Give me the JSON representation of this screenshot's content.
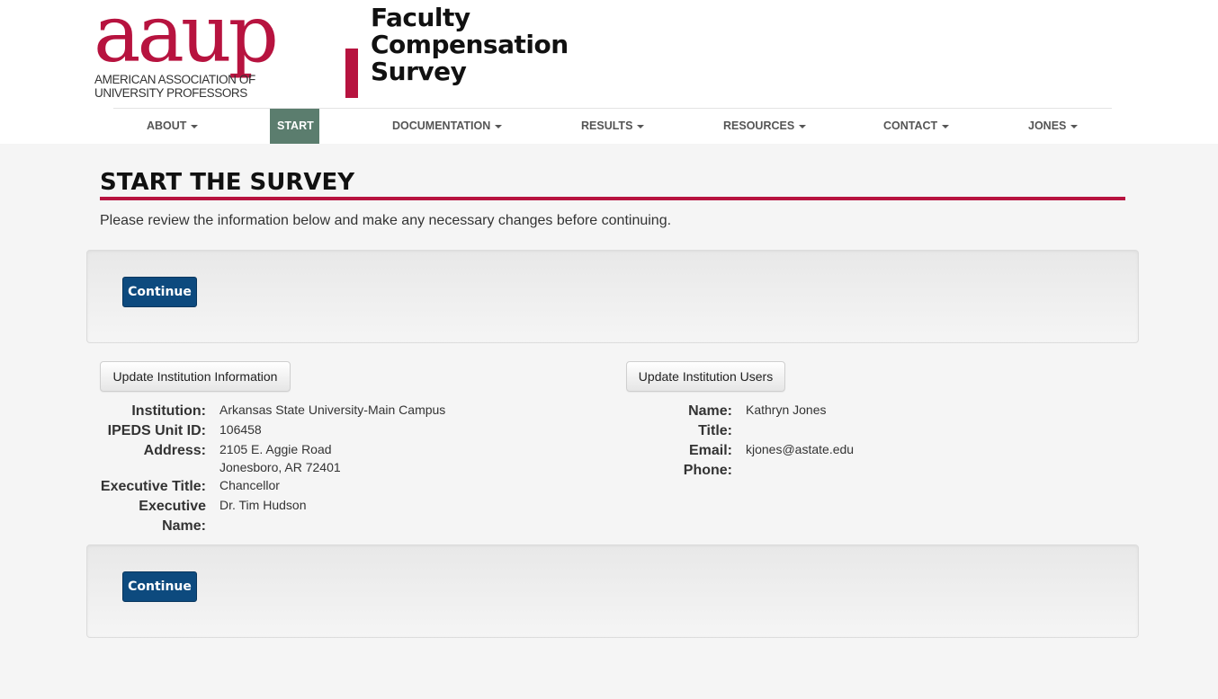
{
  "brand": {
    "logo_word": "aaup",
    "logo_sub": "American Association of University Professors",
    "site_title": "Faculty Compensation Survey",
    "brand_color": "#b7133f"
  },
  "nav": {
    "items": [
      {
        "label": "ABOUT",
        "dropdown": true
      },
      {
        "label": "START",
        "dropdown": false,
        "active": true
      },
      {
        "label": "DOCUMENTATION",
        "dropdown": true
      },
      {
        "label": "RESULTS",
        "dropdown": true
      },
      {
        "label": "RESOURCES",
        "dropdown": true
      },
      {
        "label": "CONTACT",
        "dropdown": true
      },
      {
        "label": "JONES",
        "dropdown": true
      }
    ],
    "active_color": "#5b7d6e"
  },
  "page": {
    "heading": "START THE SURVEY",
    "intro": "Please review the information below and make any necessary changes before continuing.",
    "continue_label": "Continue"
  },
  "institution": {
    "update_button": "Update Institution Information",
    "fields": [
      {
        "label": "Institution:",
        "value": "Arkansas State University-Main Campus"
      },
      {
        "label": "IPEDS Unit ID:",
        "value": "106458"
      },
      {
        "label": "Address:",
        "value_line1": "2105 E. Aggie Road",
        "value_line2": "Jonesboro, AR 72401"
      },
      {
        "label": "Executive Title:",
        "value": "Chancellor"
      },
      {
        "label_line1": "Executive",
        "label_line2": "Name:",
        "value": "Dr. Tim Hudson"
      }
    ]
  },
  "users": {
    "update_button": "Update Institution Users",
    "fields": [
      {
        "label": "Name:",
        "value": "Kathryn Jones"
      },
      {
        "label": "Title:",
        "value": ""
      },
      {
        "label": "Email:",
        "value": "kjones@astate.edu"
      },
      {
        "label": "Phone:",
        "value": ""
      }
    ]
  }
}
